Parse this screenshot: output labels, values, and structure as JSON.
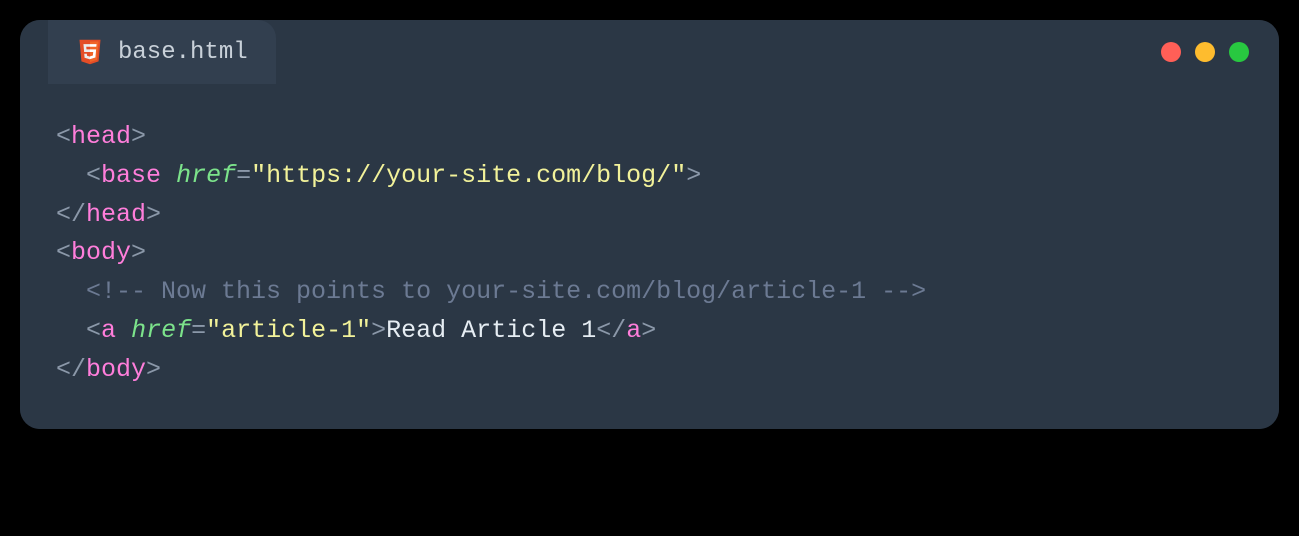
{
  "tab": {
    "filename": "base.html",
    "icon": "html5-icon"
  },
  "traffic": {
    "red": "#ff5f57",
    "yellow": "#febc2e",
    "green": "#28c840"
  },
  "code": {
    "line1": {
      "open": "<",
      "tag": "head",
      "close": ">"
    },
    "line2": {
      "indent": "  ",
      "open": "<",
      "tag": "base",
      "sp": " ",
      "attr": "href",
      "eq": "=",
      "qo": "\"",
      "val": "https://your-site.com/blog/",
      "qc": "\"",
      "close": ">"
    },
    "line3": {
      "open": "</",
      "tag": "head",
      "close": ">"
    },
    "line4": {
      "open": "<",
      "tag": "body",
      "close": ">"
    },
    "line5": {
      "indent": "  ",
      "comment": "<!-- Now this points to your-site.com/blog/article-1 -->"
    },
    "line6": {
      "indent": "  ",
      "open": "<",
      "tag": "a",
      "sp": " ",
      "attr": "href",
      "eq": "=",
      "qo": "\"",
      "val": "article-1",
      "qc": "\"",
      "close": ">",
      "text": "Read Article 1",
      "copen": "</",
      "ctag": "a",
      "cclose": ">"
    },
    "line7": {
      "open": "</",
      "tag": "body",
      "close": ">"
    }
  }
}
